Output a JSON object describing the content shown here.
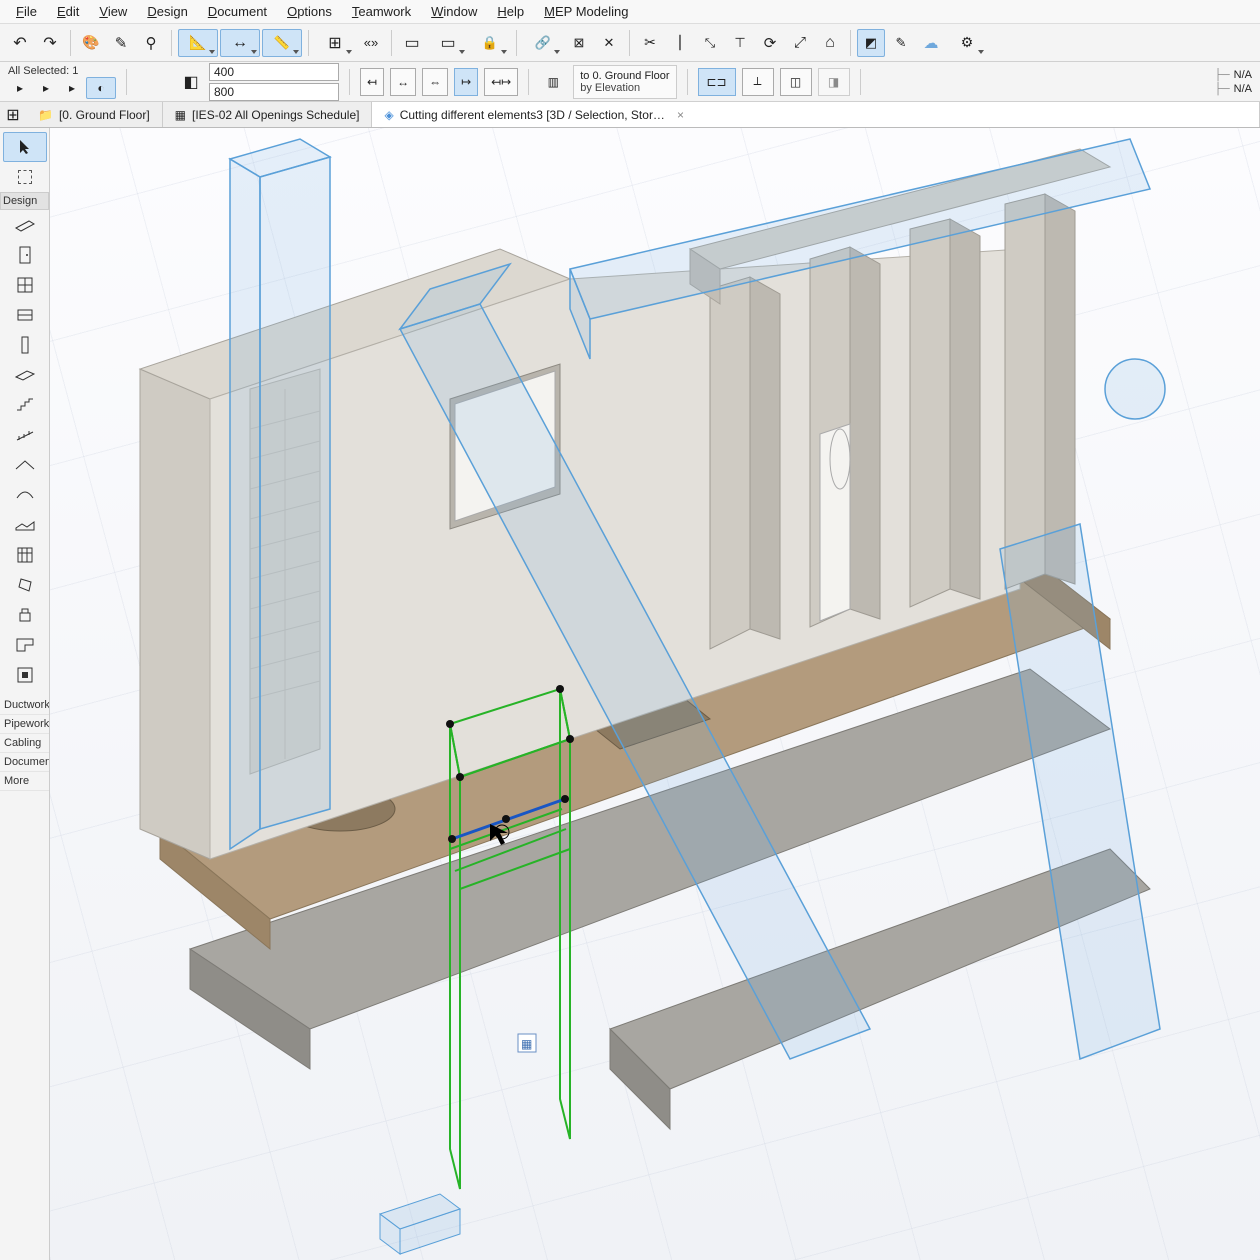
{
  "menu": {
    "items": [
      "File",
      "Edit",
      "View",
      "Design",
      "Document",
      "Options",
      "Teamwork",
      "Window",
      "Help",
      "MEP Modeling"
    ]
  },
  "selection": {
    "label": "All Selected: 1"
  },
  "dimensions": {
    "w": "400",
    "h": "800"
  },
  "story": {
    "line1": "to 0. Ground Floor",
    "line2": "by Elevation"
  },
  "right_labels": {
    "a": "N/A",
    "b": "N/A"
  },
  "tabs": [
    {
      "label": "[0. Ground Floor]",
      "icon": "folder-icon",
      "active": false
    },
    {
      "label": "[IES-02 All Openings Schedule]",
      "icon": "schedule-icon",
      "active": false
    },
    {
      "label": "Cutting different elements3 [3D / Selection, Stor…",
      "icon": "3d-icon",
      "active": true,
      "closable": true
    }
  ],
  "toolbox": {
    "sections": [
      {
        "label": "Design",
        "tools": [
          "wall-tool",
          "door-tool",
          "window-tool",
          "slab-tool",
          "column-tool",
          "beam-tool",
          "mesh-tool",
          "stair-tool",
          "roof-tool",
          "shell-tool",
          "morph-tool",
          "curtainwall-tool",
          "object-tool",
          "zone-tool",
          "opening-tool"
        ]
      }
    ],
    "more": [
      "Ductwork",
      "Pipework",
      "Cabling",
      "Document",
      "More"
    ]
  },
  "viewport": {
    "tab_prefix_icon": "grid-icon"
  }
}
